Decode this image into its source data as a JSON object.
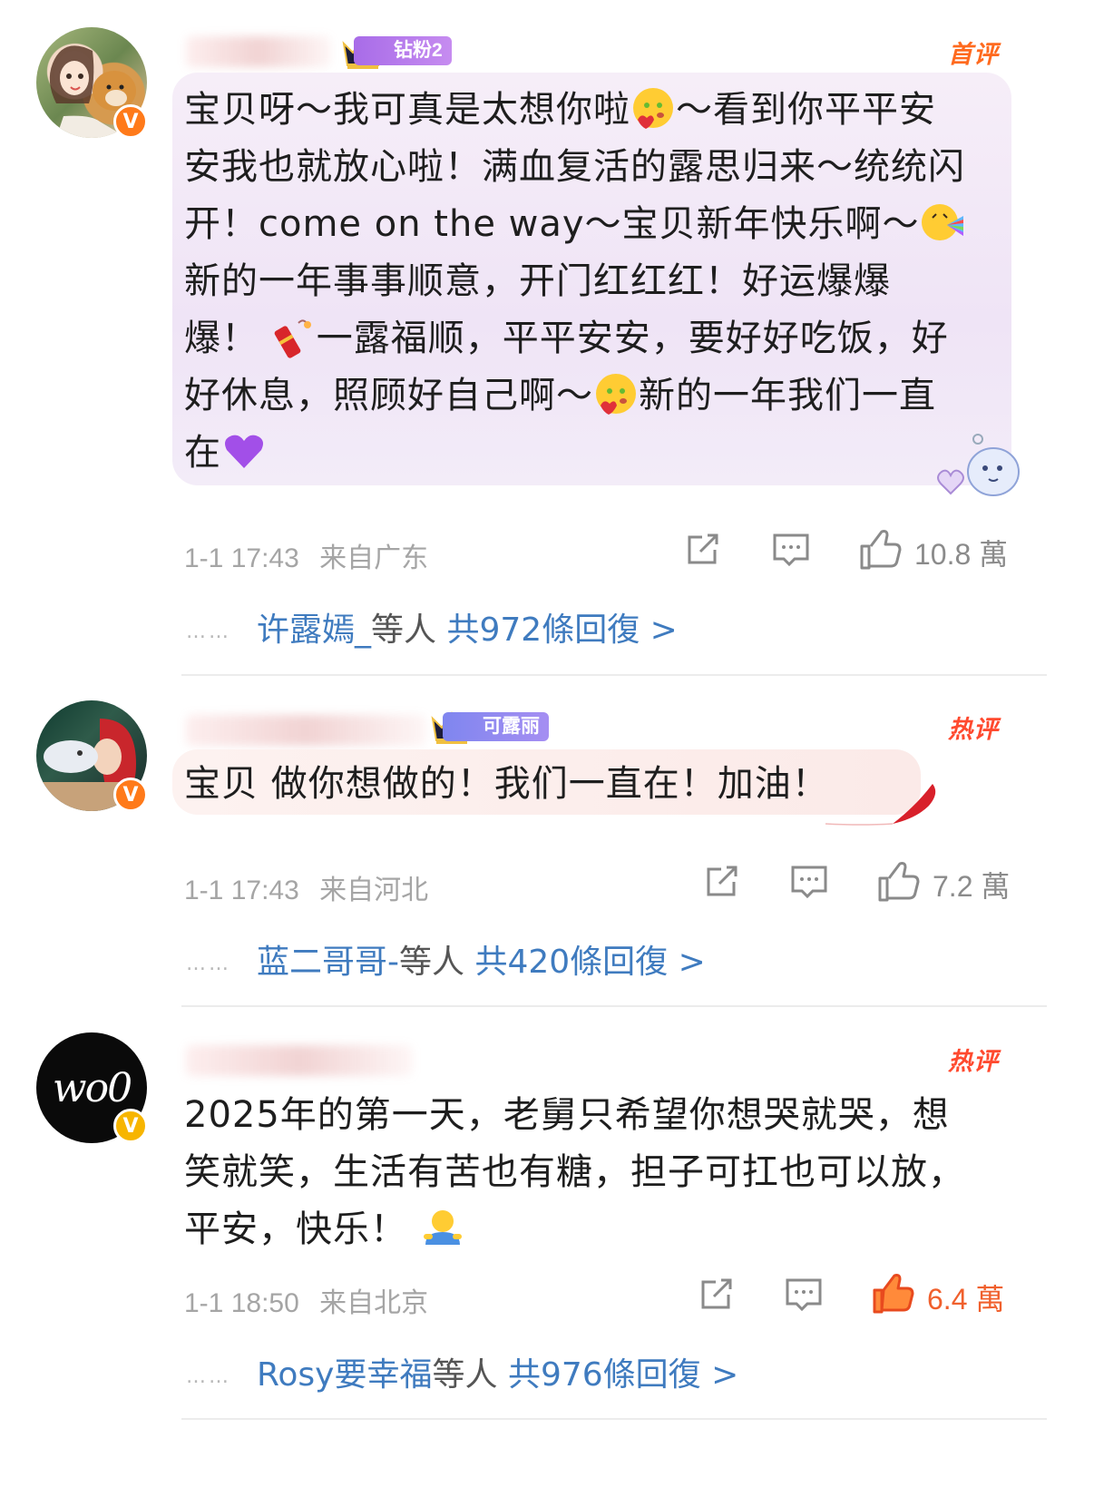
{
  "comments": [
    {
      "tag": "首评",
      "fan_badge": "钻粉2",
      "text_lines": [
        "宝贝呀～我可真是太想你啦",
        "～看到你平平安",
        "安我也就放心啦！满血复活的露思归来～统统闪",
        "开！come on the way～宝贝新年快乐啊～",
        "新的一年事事顺意，开门红红红！好运爆爆",
        "爆！",
        "一露福顺，平平安安，要好好吃饭，好",
        "好休息，照顾好自己啊～",
        "新的一年我们一直",
        "在"
      ],
      "time": "1-1 17:43",
      "location": "来自广东",
      "likes": "10.8 萬",
      "reply_names": "许露嫣_",
      "reply_others": "等人",
      "reply_count": "共972條回復 >",
      "avatar_badge_color": "#ff7a1a"
    },
    {
      "tag": "热评",
      "fan_badge": "可露丽",
      "text_lines": [
        "宝贝 做你想做的！我们一直在！加油！"
      ],
      "time": "1-1 17:43",
      "location": "来自河北",
      "likes": "7.2 萬",
      "reply_names": "蓝二哥哥-",
      "reply_others": "等人",
      "reply_count": "共420條回復 >",
      "avatar_badge_color": "#ff7a1a"
    },
    {
      "tag": "热评",
      "text_lines": [
        "2025年的第一天，老舅只希望你想哭就哭，想",
        "笑就笑，生活有苦也有糖，担子可扛也可以放，",
        "平安，快乐！"
      ],
      "time": "1-1 18:50",
      "location": "来自北京",
      "likes": "6.4 萬",
      "reply_names": "Rosy要幸福",
      "reply_others": "等人",
      "reply_count": "共976條回復 >",
      "avatar_badge_color": "#f7b500",
      "avatar_text": "wo0"
    }
  ],
  "icons": {
    "share": "share-icon",
    "comment": "comment-icon",
    "like": "like-icon"
  },
  "colors": {
    "reply_blue": "#3f7bbf",
    "like_active": "#f0602d",
    "hot_tag": "#ff4a2f"
  }
}
